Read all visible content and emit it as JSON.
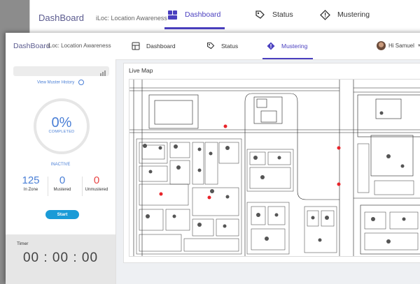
{
  "back_window": {
    "brand": "DashBoard",
    "subtitle": "iLoc: Location Awareness",
    "tabs": [
      {
        "label": "Dashboard",
        "icon": "dashboard-icon",
        "active": true
      },
      {
        "label": "Status",
        "icon": "tag-icon",
        "active": false
      },
      {
        "label": "Mustering",
        "icon": "alert-icon",
        "active": false
      }
    ]
  },
  "header": {
    "brand": "DashBoard",
    "subtitle": "iLoc: Location Awareness",
    "tabs": [
      {
        "label": "Dashboard",
        "icon": "dashboard-icon",
        "active": false
      },
      {
        "label": "Status",
        "icon": "tag-icon",
        "active": false
      },
      {
        "label": "Mustering",
        "icon": "alert-icon",
        "active": true
      }
    ],
    "user": {
      "greeting": "Hi Samuel"
    }
  },
  "sidebar": {
    "search": {
      "placeholder": "",
      "value": ""
    },
    "history_link": "View Muster History",
    "progress": {
      "percent": 0,
      "percent_text": "0%",
      "label": "COMPLETED"
    },
    "status": "INACTIVE",
    "stats": [
      {
        "value": "125",
        "label": "In Zone",
        "color": "#4a7fd6"
      },
      {
        "value": "0",
        "label": "Mustered",
        "color": "#4a7fd6"
      },
      {
        "value": "0",
        "label": "Unmustered",
        "color": "#e84545"
      }
    ],
    "start_button": "Start",
    "timer": {
      "title": "Timer",
      "value": "00 : 00 : 00"
    }
  },
  "main": {
    "title": "Live Map",
    "markers_color": "#e8242a"
  },
  "colors": {
    "accent": "#4a3fbf",
    "brand": "#5b5b8f",
    "link": "#4a7fd6",
    "start": "#1a9bd7",
    "alert": "#e84545"
  }
}
